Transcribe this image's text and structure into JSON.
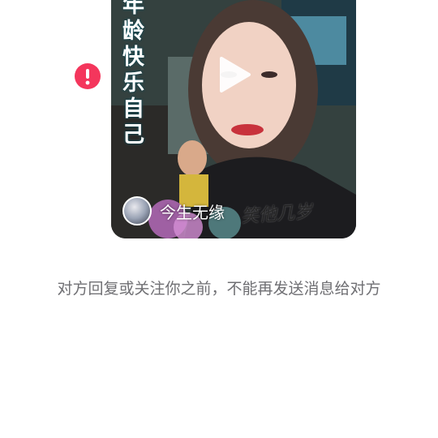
{
  "video_card": {
    "overlay_lines": [
      "年",
      "龄",
      "快",
      "乐",
      "自",
      "己"
    ],
    "author_name": "今生无缘",
    "signature": "笑他几岁"
  },
  "notice": {
    "text": "对方回复或关注你之前，不能再发送消息给对方"
  },
  "icons": {
    "error": "exclamation-icon",
    "play": "play-icon",
    "accent_color": "#f4365c"
  }
}
